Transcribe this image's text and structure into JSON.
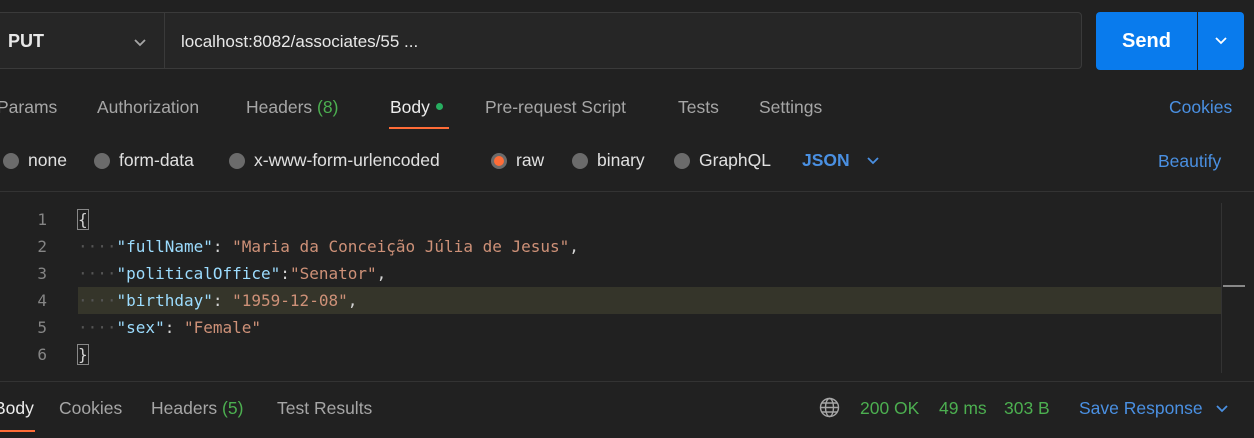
{
  "request": {
    "method": "PUT",
    "url": "localhost:8082/associates/55 ...",
    "send_label": "Send"
  },
  "tabs": [
    {
      "label": "Params"
    },
    {
      "label": "Authorization"
    },
    {
      "label": "Headers",
      "count": "(8)"
    },
    {
      "label": "Body"
    },
    {
      "label": "Pre-request Script"
    },
    {
      "label": "Tests"
    },
    {
      "label": "Settings"
    }
  ],
  "cookies_label": "Cookies",
  "body_types": [
    {
      "label": "none"
    },
    {
      "label": "form-data"
    },
    {
      "label": "x-www-form-urlencoded"
    },
    {
      "label": "raw",
      "selected": true
    },
    {
      "label": "binary"
    },
    {
      "label": "GraphQL"
    }
  ],
  "format": "JSON",
  "beautify_label": "Beautify",
  "editor": {
    "lines": [
      {
        "n": "1",
        "text": "{"
      },
      {
        "n": "2",
        "key": "\"fullName\"",
        "sep": ": ",
        "value": "\"Maria da Conceição Júlia de Jesus\"",
        "end": ","
      },
      {
        "n": "3",
        "key": "\"politicalOffice\"",
        "sep": ":",
        "value": "\"Senator\"",
        "end": ","
      },
      {
        "n": "4",
        "key": "\"birthday\"",
        "sep": ": ",
        "value": "\"1959-12-08\"",
        "end": ","
      },
      {
        "n": "5",
        "key": "\"sex\"",
        "sep": ": ",
        "value": "\"Female\"",
        "end": ""
      },
      {
        "n": "6",
        "text": "}"
      }
    ]
  },
  "response": {
    "tabs": [
      {
        "label": "Body"
      },
      {
        "label": "Cookies"
      },
      {
        "label": "Headers",
        "count": "(5)"
      },
      {
        "label": "Test Results"
      }
    ],
    "status": "200 OK",
    "time": "49 ms",
    "size": "303 B",
    "save_label": "Save Response"
  },
  "colors": {
    "accent": "#ff6c37",
    "link": "#4a90e2",
    "send": "#097bed",
    "success": "#4caf50"
  },
  "icons": [
    "chevron-down-icon",
    "globe-icon"
  ]
}
